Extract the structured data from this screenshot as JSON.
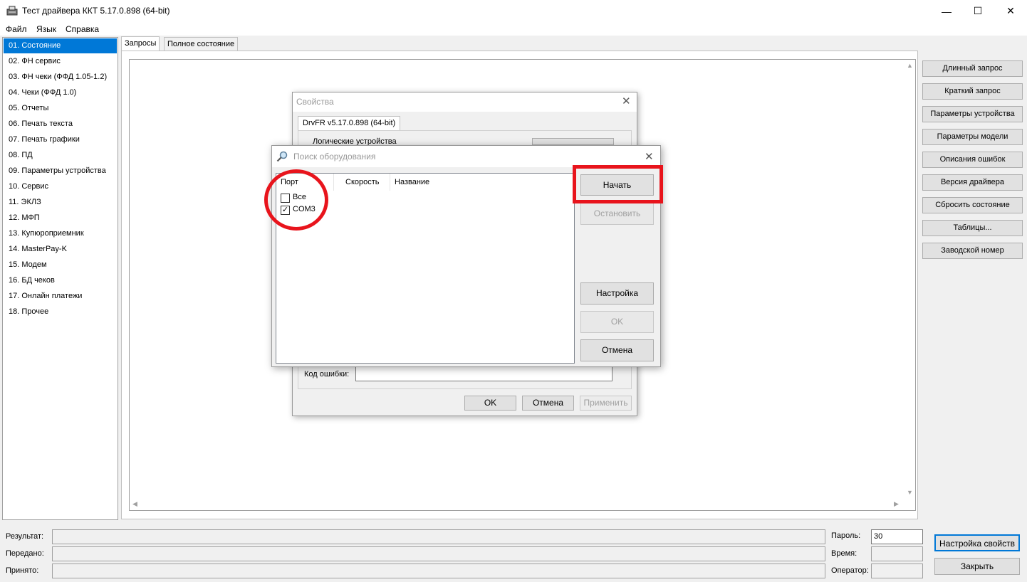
{
  "window": {
    "title": "Тест драйвера ККТ 5.17.0.898 (64-bit)",
    "minimize_glyph": "—",
    "maximize_glyph": "☐",
    "close_glyph": "✕"
  },
  "menu": [
    "Файл",
    "Язык",
    "Справка"
  ],
  "nav": {
    "selected_index": 0,
    "items": [
      "01. Состояние",
      "02. ФН сервис",
      "03. ФН чеки (ФФД 1.05-1.2)",
      "04. Чеки (ФФД 1.0)",
      "05. Отчеты",
      "06. Печать текста",
      "07. Печать графики",
      "08. ПД",
      "09. Параметры устройства",
      "10. Сервис",
      "11. ЭКЛЗ",
      "12. МФП",
      "13. Купюроприемник",
      "14. MasterPay-K",
      "15. Модем",
      "16. БД чеков",
      "17. Онлайн платежи",
      "18. Прочее"
    ]
  },
  "tabs": [
    "Запросы",
    "Полное состояние"
  ],
  "right_buttons": [
    "Длинный запрос",
    "Краткий запрос",
    "Параметры устройства",
    "Параметры модели",
    "Описания ошибок",
    "Версия драйвера",
    "Сбросить состояние",
    "Таблицы...",
    "Заводской номер"
  ],
  "status": {
    "result_label": "Результат:",
    "sent_label": "Передано:",
    "received_label": "Принято:",
    "password_label": "Пароль:",
    "password_value": "30",
    "time_label": "Время:",
    "operator_label": "Оператор:",
    "settings_button": "Настройка свойств",
    "close_button": "Закрыть"
  },
  "properties_dialog": {
    "title": "Свойства",
    "tab": "DrvFR v5.17.0.898 (64-bit)",
    "group_label": "Логические устройства",
    "error_code_label": "Код ошибки:",
    "ok": "OK",
    "cancel": "Отмена",
    "apply": "Применить"
  },
  "search_dialog": {
    "title": "Поиск оборудования",
    "columns": [
      "Порт",
      "Скорость",
      "Название"
    ],
    "ports": [
      {
        "label": "Все",
        "checked": false
      },
      {
        "label": "COM3",
        "checked": true
      }
    ],
    "buttons": {
      "start": "Начать",
      "stop": "Остановить",
      "settings": "Настройка",
      "ok": "OK",
      "cancel": "Отмена"
    }
  },
  "colors": {
    "selection": "#0078d7",
    "annotation": "#e8141c"
  }
}
